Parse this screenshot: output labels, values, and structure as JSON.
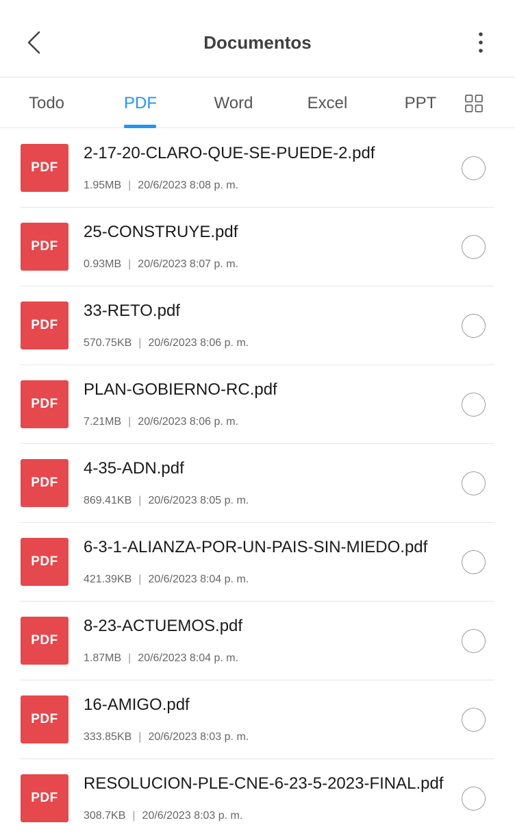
{
  "header": {
    "title": "Documentos",
    "back_icon": "chevron-left-icon",
    "menu_icon": "more-vertical-icon"
  },
  "tabs": [
    {
      "label": "Todo",
      "active": false
    },
    {
      "label": "PDF",
      "active": true
    },
    {
      "label": "Word",
      "active": false
    },
    {
      "label": "Excel",
      "active": false
    },
    {
      "label": "PPT",
      "active": false
    }
  ],
  "view_toggle_icon": "grid-view-icon",
  "colors": {
    "accent": "#2196f3",
    "pdf_icon_bg": "#e5484d",
    "title_text": "#404040"
  },
  "files": [
    {
      "icon_label": "PDF",
      "name": "2-17-20-CLARO-QUE-SE-PUEDE-2.pdf",
      "size": "1.95MB",
      "date": "20/6/2023 8:08 p. m."
    },
    {
      "icon_label": "PDF",
      "name": "25-CONSTRUYE.pdf",
      "size": "0.93MB",
      "date": "20/6/2023 8:07 p. m."
    },
    {
      "icon_label": "PDF",
      "name": "33-RETO.pdf",
      "size": "570.75KB",
      "date": "20/6/2023 8:06 p. m."
    },
    {
      "icon_label": "PDF",
      "name": "PLAN-GOBIERNO-RC.pdf",
      "size": "7.21MB",
      "date": "20/6/2023 8:06 p. m."
    },
    {
      "icon_label": "PDF",
      "name": "4-35-ADN.pdf",
      "size": "869.41KB",
      "date": "20/6/2023 8:05 p. m."
    },
    {
      "icon_label": "PDF",
      "name": "6-3-1-ALIANZA-POR-UN-PAIS-SIN-MIEDO.pdf",
      "size": "421.39KB",
      "date": "20/6/2023 8:04 p. m."
    },
    {
      "icon_label": "PDF",
      "name": "8-23-ACTUEMOS.pdf",
      "size": "1.87MB",
      "date": "20/6/2023 8:04 p. m."
    },
    {
      "icon_label": "PDF",
      "name": "16-AMIGO.pdf",
      "size": "333.85KB",
      "date": "20/6/2023 8:03 p. m."
    },
    {
      "icon_label": "PDF",
      "name": "RESOLUCION-PLE-CNE-6-23-5-2023-FINAL.pdf",
      "size": "308.7KB",
      "date": "20/6/2023 8:03 p. m."
    }
  ],
  "meta_separator": "|"
}
